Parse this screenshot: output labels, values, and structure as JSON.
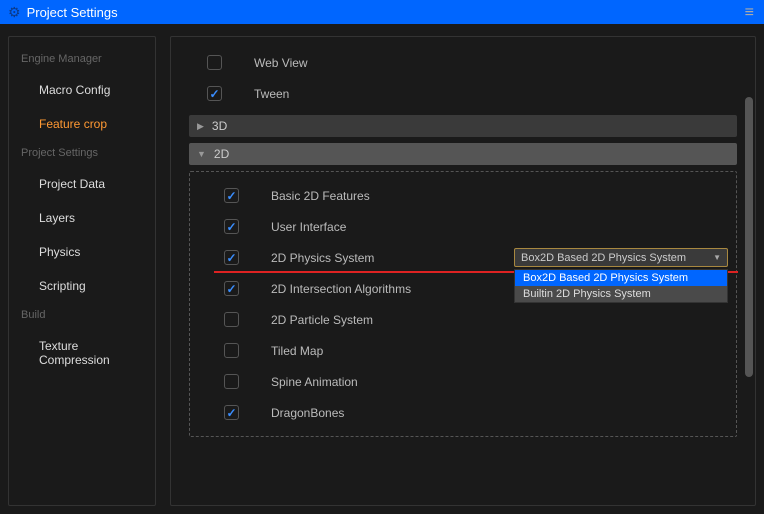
{
  "header": {
    "title": "Project Settings"
  },
  "sidebar": {
    "sections": [
      {
        "title": "Engine Manager",
        "items": [
          "Macro Config",
          "Feature crop"
        ]
      },
      {
        "title": "Project Settings",
        "items": [
          "Project Data",
          "Layers",
          "Physics",
          "Scripting"
        ]
      },
      {
        "title": "Build",
        "items": [
          "Texture Compression"
        ]
      }
    ],
    "active_item": "Feature crop"
  },
  "top_features": [
    {
      "label": "Web View",
      "checked": false
    },
    {
      "label": "Tween",
      "checked": true
    }
  ],
  "groups": {
    "g3d": {
      "title": "3D",
      "expanded": false
    },
    "g2d": {
      "title": "2D",
      "expanded": true
    }
  },
  "features_2d": [
    {
      "label": "Basic 2D Features",
      "checked": true
    },
    {
      "label": "User Interface",
      "checked": true
    },
    {
      "label": "2D Physics System",
      "checked": true,
      "has_dropdown": true
    },
    {
      "label": "2D Intersection Algorithms",
      "checked": true
    },
    {
      "label": "2D Particle System",
      "checked": false
    },
    {
      "label": "Tiled Map",
      "checked": false
    },
    {
      "label": "Spine Animation",
      "checked": false
    },
    {
      "label": "DragonBones",
      "checked": true
    }
  ],
  "physics_dropdown": {
    "selected": "Box2D Based 2D Physics System",
    "options": [
      "Box2D Based 2D Physics System",
      "Builtin 2D Physics System"
    ]
  }
}
